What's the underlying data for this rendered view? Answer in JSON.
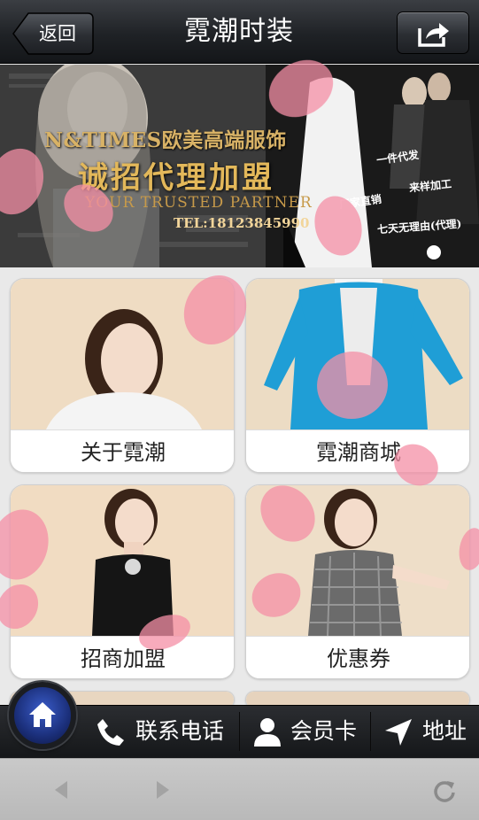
{
  "header": {
    "back_label": "返回",
    "title": "霓潮时装",
    "share_icon": "share-icon"
  },
  "banner": {
    "brand_line": "N&TIMES欧美高端服饰",
    "slogan": "诚招代理加盟",
    "tagline": "YOUR TRUSTED PARTNER",
    "tel": "TEL:18123845990",
    "highlights": [
      "一件代发",
      "来样加工",
      "厂家直销",
      "七天无理由(代理)"
    ],
    "slide_indicator_count": 1
  },
  "tiles": [
    {
      "label": "关于霓潮",
      "photo_bg": "#efdcc3",
      "garment": "#f4f4f4"
    },
    {
      "label": "霓潮商城",
      "photo_bg": "#ecdcc4",
      "garment": "#1f9ed6"
    },
    {
      "label": "招商加盟",
      "photo_bg": "#f1dcc2",
      "garment": "#151515"
    },
    {
      "label": "优惠券",
      "photo_bg": "#eedec8",
      "garment": "#6b6b6b"
    }
  ],
  "bottom_nav": {
    "home_icon": "home-icon",
    "items": [
      {
        "label": "联系电话",
        "icon": "phone-icon"
      },
      {
        "label": "会员卡",
        "icon": "user-icon"
      },
      {
        "label": "地址",
        "icon": "location-arrow-icon"
      }
    ]
  },
  "browser_toolbar": {
    "back_icon": "browser-back-icon",
    "forward_icon": "browser-forward-icon",
    "refresh_icon": "refresh-icon"
  },
  "colors": {
    "header_dark": "#1f2226",
    "banner_gold": "#d8b266",
    "petal_pink": "#f58fa6",
    "home_blue": "#2a46a8"
  }
}
